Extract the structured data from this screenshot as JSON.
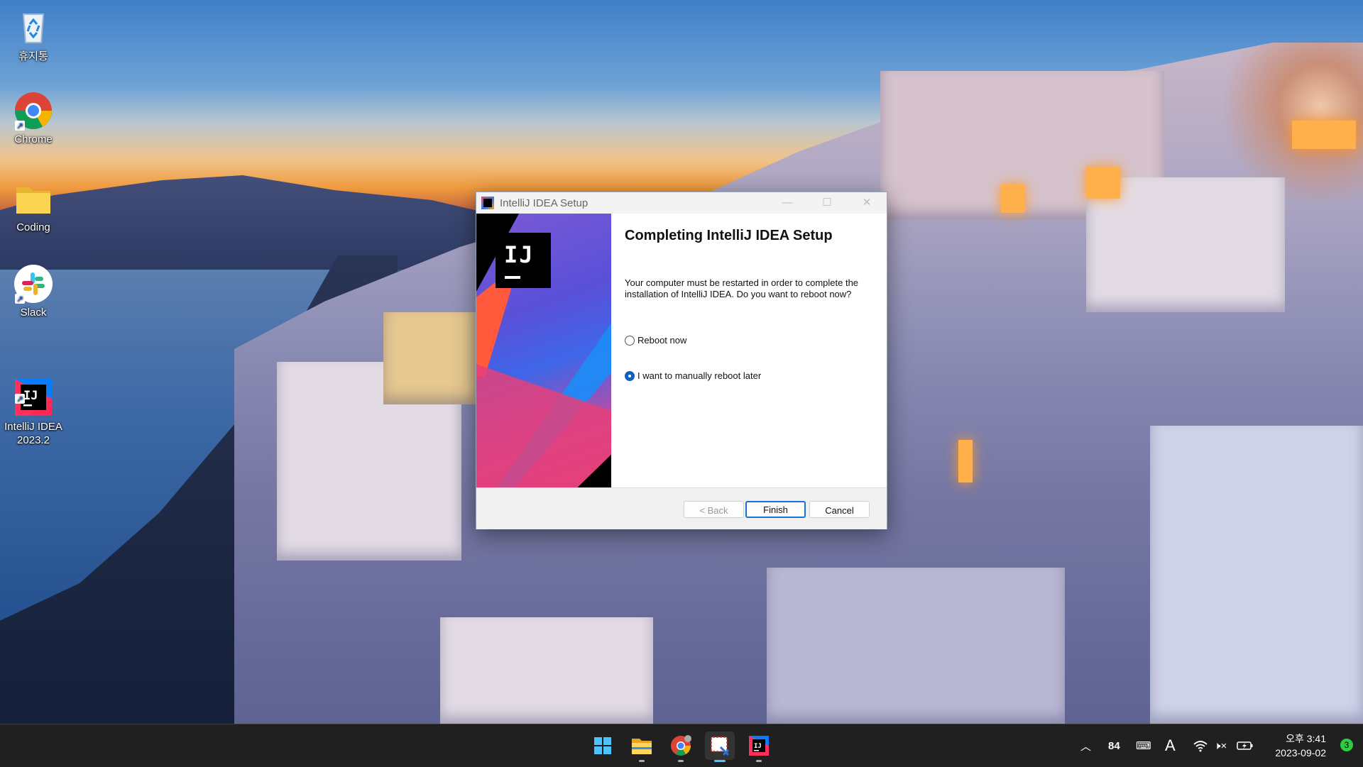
{
  "desktop": {
    "icons": [
      {
        "label": "휴지통"
      },
      {
        "label": "Chrome"
      },
      {
        "label": "Coding"
      },
      {
        "label": "Slack"
      },
      {
        "label": "IntelliJ IDEA\n2023.2"
      }
    ]
  },
  "dialog": {
    "title": "IntelliJ IDEA Setup",
    "heading": "Completing IntelliJ IDEA Setup",
    "message": "Your computer must be restarted in order to complete the installation of IntelliJ IDEA. Do you want to reboot now?",
    "logo_text": "IJ",
    "options": [
      {
        "label": "Reboot now",
        "selected": false
      },
      {
        "label": "I want to manually reboot later",
        "selected": true
      }
    ],
    "buttons": {
      "back": "< Back",
      "finish": "Finish",
      "cancel": "Cancel"
    }
  },
  "taskbar": {
    "apps": [
      "start-icon",
      "file-explorer-icon",
      "chrome-icon",
      "snipping-tool-icon",
      "intellij-icon"
    ],
    "tray": {
      "weather_value": "84",
      "ime_mode": "A"
    },
    "clock": {
      "time": "오후 3:41",
      "date": "2023-09-02"
    },
    "notification_count": "3"
  },
  "colors": {
    "accent": "#1a6fd8",
    "taskbar": "#202020",
    "dialog_bg": "#f0f0f0"
  }
}
